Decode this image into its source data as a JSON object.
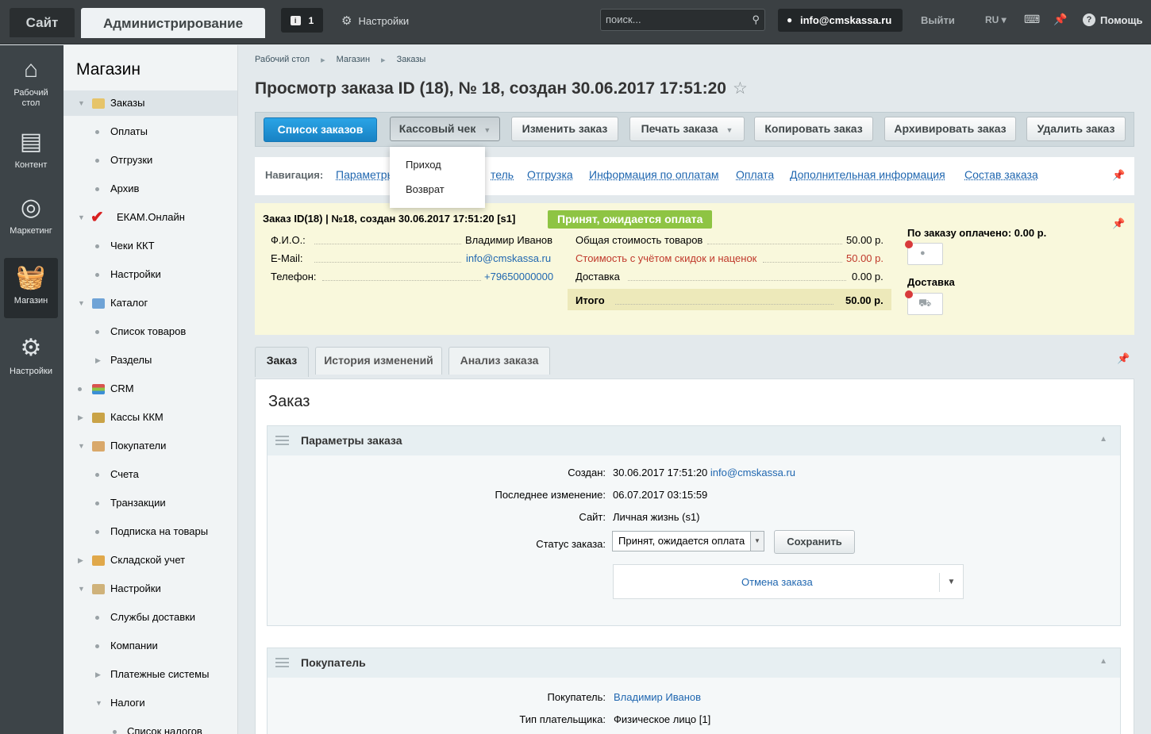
{
  "topbar": {
    "site": "Сайт",
    "admin": "Администрирование",
    "notif_count": "1",
    "settings": "Настройки",
    "search_placeholder": "поиск...",
    "user": "info@cmskassa.ru",
    "exit": "Выйти",
    "lang": "RU",
    "help": "Помощь"
  },
  "leftnav": [
    {
      "label": "Рабочий стол",
      "icon": "home-icon"
    },
    {
      "label": "Контент",
      "icon": "document-icon"
    },
    {
      "label": "Маркетинг",
      "icon": "target-icon"
    },
    {
      "label": "Магазин",
      "icon": "basket-icon"
    },
    {
      "label": "Настройки",
      "icon": "gear-icon"
    }
  ],
  "sidebar": {
    "title": "Магазин",
    "items": [
      {
        "label": "Заказы"
      },
      {
        "label": "Оплаты"
      },
      {
        "label": "Отгрузки"
      },
      {
        "label": "Архив"
      },
      {
        "label": "ЕКАМ.Онлайн"
      },
      {
        "label": "Чеки ККТ"
      },
      {
        "label": "Настройки"
      },
      {
        "label": "Каталог"
      },
      {
        "label": "Список товаров"
      },
      {
        "label": "Разделы"
      },
      {
        "label": "CRM"
      },
      {
        "label": "Кассы ККМ"
      },
      {
        "label": "Покупатели"
      },
      {
        "label": "Счета"
      },
      {
        "label": "Транзакции"
      },
      {
        "label": "Подписка на товары"
      },
      {
        "label": "Складской учет"
      },
      {
        "label": "Настройки"
      },
      {
        "label": "Службы доставки"
      },
      {
        "label": "Компании"
      },
      {
        "label": "Платежные системы"
      },
      {
        "label": "Налоги"
      },
      {
        "label": "Список налогов"
      }
    ]
  },
  "breadcrumb": [
    "Рабочий стол",
    "Магазин",
    "Заказы"
  ],
  "page_title": "Просмотр заказа ID (18), № 18, создан 30.06.2017 17:51:20",
  "toolbar": {
    "list": "Список заказов",
    "receipt": "Кассовый чек",
    "edit": "Изменить заказ",
    "print": "Печать заказа",
    "copy": "Копировать заказ",
    "archive": "Архивировать заказ",
    "delete": "Удалить заказ"
  },
  "receipt_menu": [
    "Приход",
    "Возврат"
  ],
  "nav": {
    "label": "Навигация:",
    "links": [
      "Параметры",
      "тель",
      "Отгрузка",
      "Информация по оплатам",
      "Оплата",
      "Дополнительная информация",
      "Состав заказа"
    ]
  },
  "summary": {
    "title": "Заказ ID(18) | №18, создан 30.06.2017 17:51:20 [s1]",
    "status": "Принят, ожидается оплата",
    "fio_label": "Ф.И.О.:",
    "fio": "Владимир Иванов",
    "email_label": "E-Mail:",
    "email": "info@cmskassa.ru",
    "phone_label": "Телефон:",
    "phone": "+79650000000",
    "goods_label": "Общая стоимость товаров",
    "goods": "50.00 р.",
    "discount_label": "Стоимость с учётом скидок и наценок",
    "discount": "50.00 р.",
    "delivery_label": "Доставка",
    "delivery": "0.00 р.",
    "total_label": "Итого",
    "total": "50.00 р.",
    "paid": "По заказу оплачено: 0.00 р.",
    "shipping": "Доставка",
    "status_color": "#8ec443",
    "alert_color": "#d83a3a"
  },
  "tabs": [
    "Заказ",
    "История изменений",
    "Анализ заказа"
  ],
  "order": {
    "heading": "Заказ",
    "params_title": "Параметры заказа",
    "created_label": "Создан:",
    "created": "30.06.2017 17:51:20",
    "created_by": "info@cmskassa.ru",
    "modified_label": "Последнее изменение:",
    "modified": "06.07.2017 03:15:59",
    "site_label": "Сайт:",
    "site": "Личная жизнь (s1)",
    "status_label": "Статус заказа:",
    "status": "Принят, ожидается оплата",
    "save": "Сохранить",
    "cancel": "Отмена заказа",
    "buyer_title": "Покупатель",
    "buyer_label": "Покупатель:",
    "buyer": "Владимир Иванов",
    "payer_label": "Тип плательщика:",
    "payer": "Физическое лицо [1]"
  }
}
